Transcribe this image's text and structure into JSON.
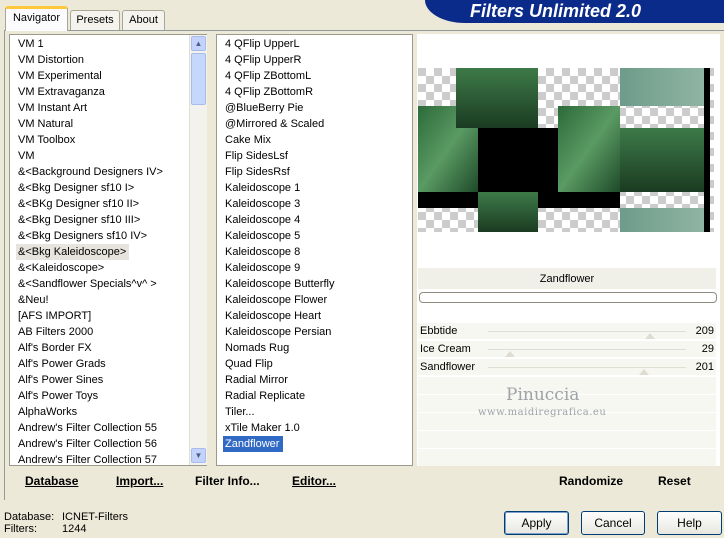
{
  "tabs": [
    {
      "label": "Navigator"
    },
    {
      "label": "Presets"
    },
    {
      "label": "About"
    }
  ],
  "app_title": "Filters Unlimited 2.0",
  "categories": [
    "VM 1",
    "VM Distortion",
    "VM Experimental",
    "VM Extravaganza",
    "VM Instant Art",
    "VM Natural",
    "VM Toolbox",
    "VM",
    "&<Background Designers IV>",
    "&<Bkg Designer sf10 I>",
    "&<BKg Designer sf10 II>",
    "&<Bkg Designer sf10 III>",
    "&<Bkg Designers sf10 IV>",
    "&<Bkg Kaleidoscope>",
    "&<Kaleidoscope>",
    "&<Sandflower Specials^v^ >",
    "&Neu!",
    "[AFS IMPORT]",
    "AB Filters 2000",
    "Alf's Border FX",
    "Alf's Power Grads",
    "Alf's Power Sines",
    "Alf's Power Toys",
    "AlphaWorks",
    "Andrew's Filter Collection 55",
    "Andrew's Filter Collection 56",
    "Andrew's Filter Collection 57"
  ],
  "selected_category": "&<Bkg Kaleidoscope>",
  "filters": [
    "4 QFlip UpperL",
    "4 QFlip UpperR",
    "4 QFlip ZBottomL",
    "4 QFlip ZBottomR",
    "@BlueBerry Pie",
    "@Mirrored & Scaled",
    "Cake Mix",
    "Flip SidesLsf",
    "Flip SidesRsf",
    "Kaleidoscope 1",
    "Kaleidoscope 3",
    "Kaleidoscope 4",
    "Kaleidoscope 5",
    "Kaleidoscope 8",
    "Kaleidoscope 9",
    "Kaleidoscope Butterfly",
    "Kaleidoscope Flower",
    "Kaleidoscope Heart",
    "Kaleidoscope Persian",
    "Nomads Rug",
    "Quad Flip",
    "Radial Mirror",
    "Radial Replicate",
    "Tiler...",
    "xTile Maker 1.0",
    "Zandflower"
  ],
  "selected_filter": "Zandflower",
  "list_buttons": {
    "database": "Database",
    "import": "Import...",
    "filter_info": "Filter Info...",
    "editor": "Editor..."
  },
  "filter_display_name": "Zandflower",
  "sliders": [
    {
      "name": "Ebbtide",
      "value": "209",
      "level": 0.82
    },
    {
      "name": "Ice Cream",
      "value": "29",
      "level": 0.11
    },
    {
      "name": "Sandflower",
      "value": "201",
      "level": 0.79
    }
  ],
  "watermark": {
    "name": "Pinuccia",
    "site": "www.maidiregrafica.eu"
  },
  "right_buttons": {
    "randomize": "Randomize",
    "reset": "Reset"
  },
  "status": {
    "database_label": "Database:",
    "database_value": "ICNET-Filters",
    "filters_label": "Filters:",
    "filters_value": "1244"
  },
  "dialog_buttons": {
    "apply": "Apply",
    "cancel": "Cancel",
    "help": "Help"
  },
  "colors": {
    "title_bar": "#0b2b8b",
    "selection": "#316ac5",
    "tab_highlight": "#ffc83c"
  },
  "icons": {
    "scroll_up": "scroll-up-arrow-icon",
    "scroll_down": "scroll-down-arrow-icon"
  }
}
